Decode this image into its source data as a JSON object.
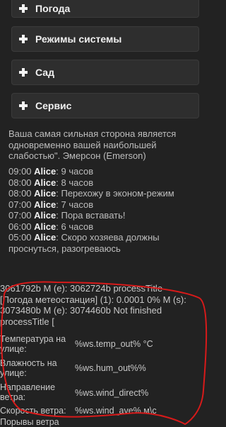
{
  "menu": {
    "items": [
      {
        "label": "Погода"
      },
      {
        "label": "Режимы системы"
      },
      {
        "label": "Сад"
      },
      {
        "label": "Сервис"
      }
    ]
  },
  "quote": "Ваша самая сильная сторона является одновременно вашей наибольшей слабостью\". Эмерсон (Emerson)",
  "log": [
    {
      "time": "09:00",
      "name": "Alice",
      "message": "9 часов"
    },
    {
      "time": "08:00",
      "name": "Alice",
      "message": "8 часов"
    },
    {
      "time": "08:00",
      "name": "Alice",
      "message": "Перехожу в эконом-режим"
    },
    {
      "time": "07:00",
      "name": "Alice",
      "message": "7 часов"
    },
    {
      "time": "07:00",
      "name": "Alice",
      "message": "Пора вставать!"
    },
    {
      "time": "06:00",
      "name": "Alice",
      "message": "6 часов"
    },
    {
      "time": "05:00",
      "name": "Alice",
      "message": "Скоро хозяева должны"
    },
    {
      "time": "",
      "name": "",
      "message": "проснуться, разогреваюсь"
    }
  ],
  "status": {
    "line1": "3061792b M (e): 3062724b processTitle",
    "line2": "[Погода метеостанция] (1): 0.0001 0% M (s):",
    "line3": "3073480b M (e): 3074460b Not finished",
    "line4": "processTitle ["
  },
  "weather_table": [
    {
      "label": "Температура на улице:",
      "value": "%ws.temp_out% °C"
    },
    {
      "label": "Влажность на улице:",
      "value": "%ws.hum_out%%"
    },
    {
      "label": "Направление ветра:",
      "value": "%ws.wind_direct%"
    },
    {
      "label": "Скорость ветра:",
      "value": "%ws.wind_ave% м\\с"
    },
    {
      "label": "Порывы ветра",
      "value": ""
    }
  ],
  "colors": {
    "background": "#222222",
    "panel": "#2e2e2e",
    "annotation": "#d81a1a"
  }
}
